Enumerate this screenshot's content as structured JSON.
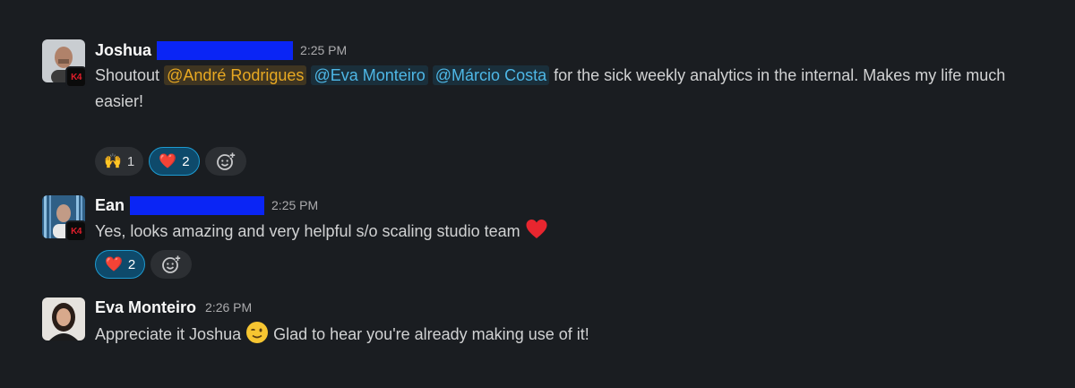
{
  "colors": {
    "background": "#1a1d21",
    "mention_blue": "#4eb7e6",
    "mention_self": "#e8a922",
    "redaction": "#0a25f5",
    "reaction_active": "#0e4a6b"
  },
  "messages": [
    {
      "author": "Joshua",
      "time": "2:25 PM",
      "avatar_icon": "user-photo-avatar",
      "badge": "K4",
      "text_parts": {
        "prefix": "Shoutout ",
        "mention1": "@André Rodrigues",
        "mention2": "@Eva Monteiro",
        "mention3": "@Márcio Costa",
        "suffix": " for the sick weekly analytics in the internal. Makes my life much easier!"
      },
      "reactions": [
        {
          "emoji": "🙌",
          "emoji_icon": "raised-hands-icon",
          "count": "1",
          "active": false
        },
        {
          "emoji": "❤️",
          "emoji_icon": "red-heart-icon",
          "count": "2",
          "active": true
        }
      ],
      "add_reaction_icon": "add-reaction-icon"
    },
    {
      "author": "Ean",
      "time": "2:25 PM",
      "avatar_icon": "user-photo-avatar",
      "badge": "K4",
      "text": "Yes, looks amazing and very helpful s/o scaling studio team ",
      "trailing_emoji_icon": "red-heart-icon",
      "reactions": [
        {
          "emoji": "❤️",
          "emoji_icon": "red-heart-icon",
          "count": "2",
          "active": true
        }
      ],
      "add_reaction_icon": "add-reaction-icon"
    },
    {
      "author": "Eva Monteiro",
      "time": "2:26 PM",
      "avatar_icon": "user-photo-avatar",
      "text_before": "Appreciate it Joshua ",
      "inline_emoji_icon": "winking-face-icon",
      "text_after": " Glad to hear you're already making use of it!"
    }
  ]
}
